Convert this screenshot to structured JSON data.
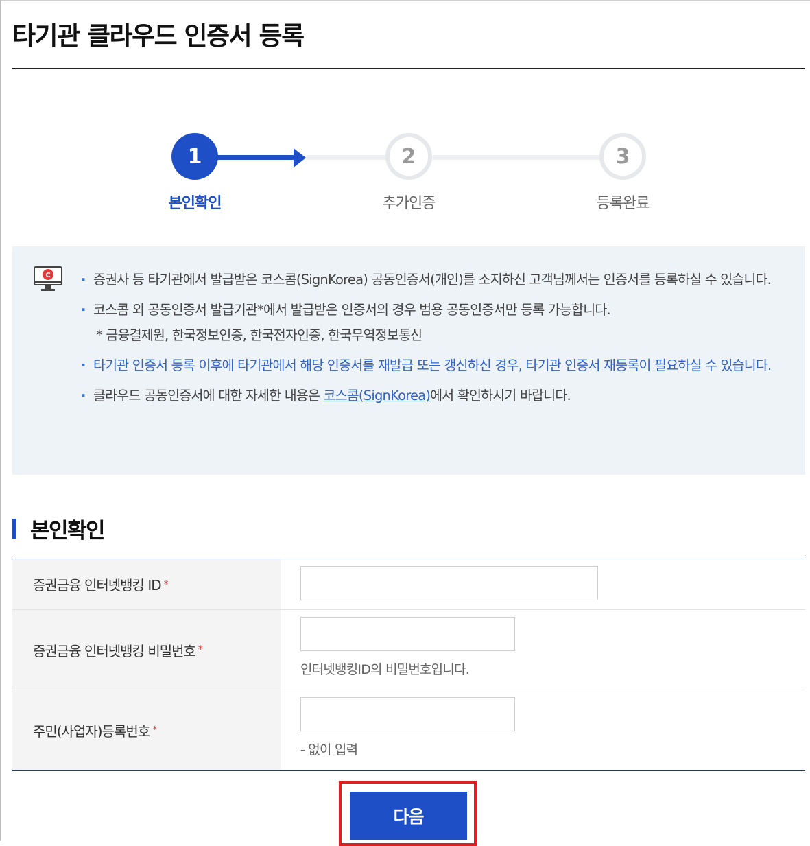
{
  "page": {
    "title": "타기관 클라우드 인증서 등록"
  },
  "stepper": {
    "steps": [
      {
        "number": "1",
        "label": "본인확인"
      },
      {
        "number": "2",
        "label": "추가인증"
      },
      {
        "number": "3",
        "label": "등록완료"
      }
    ],
    "current_step": 1
  },
  "notice": {
    "icon": "certificate-monitor-icon",
    "item1": "증권사 등 타기관에서 발급받은 코스콤(SignKorea) 공동인증서(개인)를 소지하신 고객님께서는 인증서를 등록하실 수 있습니다.",
    "item2": "코스콤 외 공동인증서 발급기관*에서 발급받은 인증서의 경우 범용 공동인증서만 등록 가능합니다.",
    "item2_sub": "* 금융결제원, 한국정보인증, 한국전자인증, 한국무역정보통신",
    "item3": "타기관 인증서 등록 이후에 타기관에서 해당 인증서를 재발급 또는 갱신하신 경우, 타기관 인증서 재등록이 필요하실 수 있습니다.",
    "item4_before": "클라우드 공동인증서에 대한 자세한 내용은 ",
    "item4_link": "코스콤(SignKorea)",
    "item4_after": "에서 확인하시기 바랍니다."
  },
  "section": {
    "title": "본인확인"
  },
  "form": {
    "required_mark": "*",
    "id_label": "증권금융 인터넷뱅킹 ID",
    "id_value": "",
    "password_label": "증권금융 인터넷뱅킹 비밀번호",
    "password_value": "",
    "password_hint": "인터넷뱅킹ID의 비밀번호입니다.",
    "rrn_label": "주민(사업자)등록번호",
    "rrn_value": "",
    "rrn_hint": "- 없이 입력"
  },
  "actions": {
    "next_label": "다음"
  },
  "colors": {
    "primary": "#1f4fc6",
    "highlight": "#e02020",
    "notice_bg": "#eef3f8"
  }
}
